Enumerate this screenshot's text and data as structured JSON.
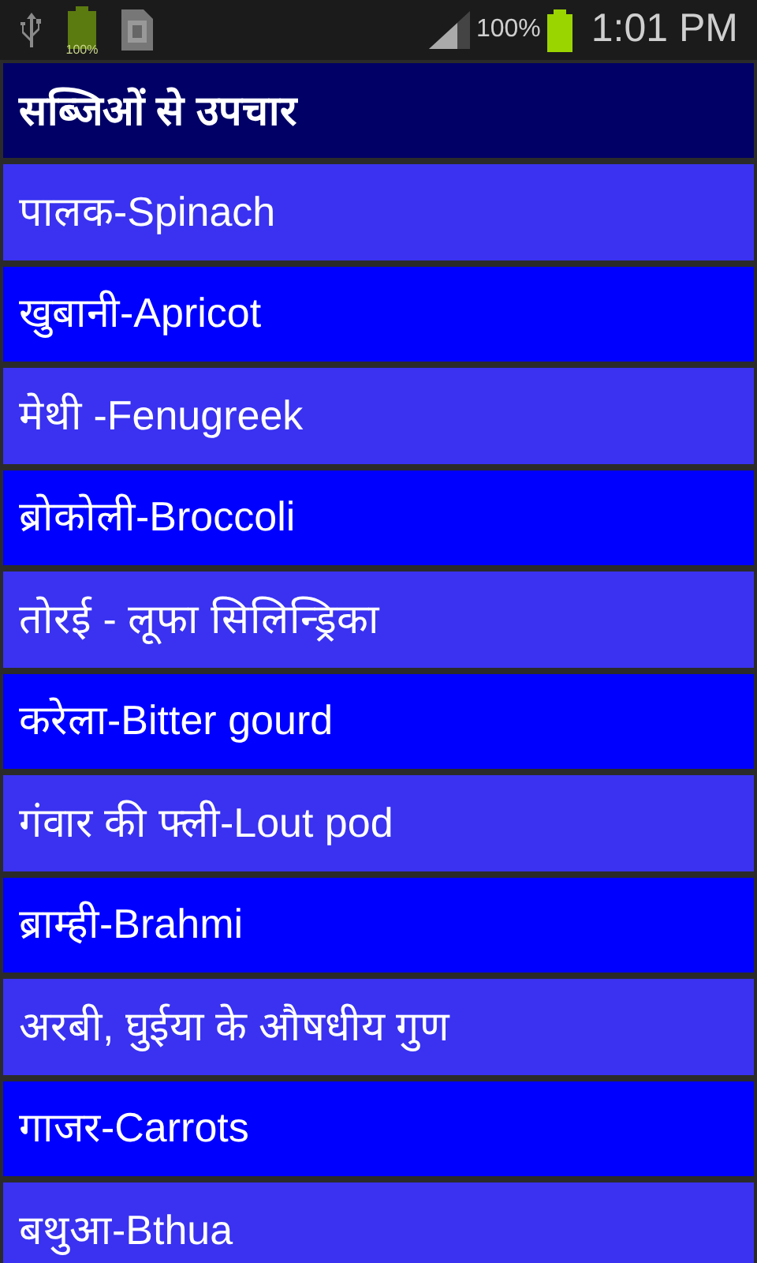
{
  "status_bar": {
    "battery_icon_label": "100%",
    "battery_percent": "100%",
    "time": "1:01 PM"
  },
  "title": "सब्जिओं से उपचार",
  "items": [
    {
      "label": "पालक-Spinach"
    },
    {
      "label": "खुबानी-Apricot"
    },
    {
      "label": "मेथी -Fenugreek"
    },
    {
      "label": "ब्रोकोली-Broccoli"
    },
    {
      "label": "तोरई - लूफा सिलिन्ड्रिका"
    },
    {
      "label": "करेला-Bitter gourd"
    },
    {
      "label": "गंवार की फ्ली-Lout pod"
    },
    {
      "label": "ब्राम्ही-Brahmi"
    },
    {
      "label": "अरबी, घुईया के औषधीय गुण"
    },
    {
      "label": "गाजर-Carrots"
    },
    {
      "label": "बथुआ-Bthua"
    }
  ]
}
